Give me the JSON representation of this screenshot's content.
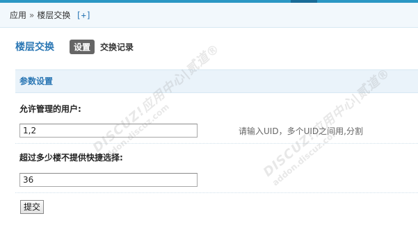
{
  "breadcrumb": {
    "root": "应用",
    "separator": "»",
    "current": "楼层交换",
    "add_label": "[+]"
  },
  "page": {
    "title": "楼层交换",
    "tabs": [
      {
        "label": "设置",
        "active": true
      },
      {
        "label": "交换记录",
        "active": false
      }
    ]
  },
  "section": {
    "title": "参数设置"
  },
  "fields": [
    {
      "label": "允许管理的用户:",
      "value": "1,2",
      "hint": "请输入UID，多个UID之间用,分割"
    },
    {
      "label": "超过多少楼不提供快捷选择:",
      "value": "36",
      "hint": ""
    }
  ],
  "actions": {
    "submit_label": "提交"
  },
  "watermark": {
    "brand": "DISCUZ!应用中心|贰道®",
    "url": "addon.discuz.com"
  },
  "colors": {
    "accent": "#2b77b4",
    "topbar": "#2b97c4",
    "section_bg": "#eaf3fa"
  }
}
